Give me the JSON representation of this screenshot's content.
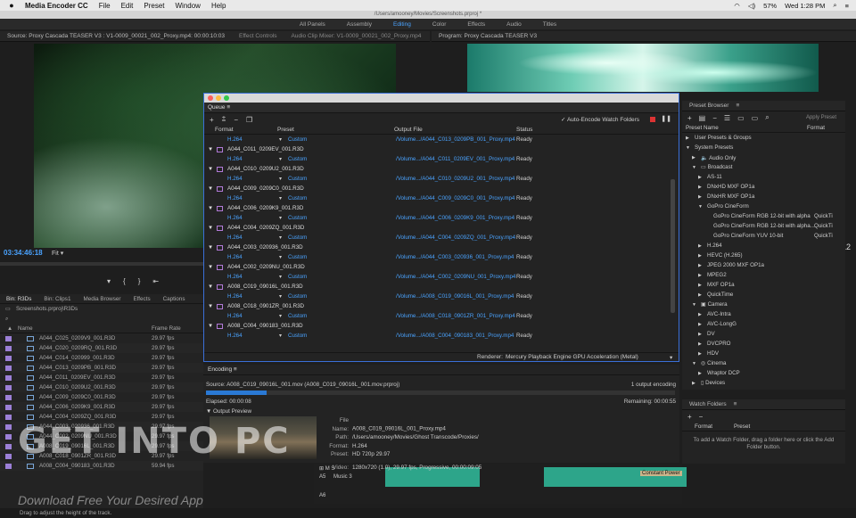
{
  "menubar": {
    "app": "Media Encoder CC",
    "items": [
      "File",
      "Edit",
      "Preset",
      "Window",
      "Help"
    ],
    "battery": "57%",
    "clock": "Wed 1:28 PM"
  },
  "window_title": "/Users/amooney/Movies/Screenshots.prproj *",
  "workspaces": [
    "All Panels",
    "Assembly",
    "Editing",
    "Color",
    "Effects",
    "Audio",
    "Titles"
  ],
  "source_panel": {
    "title": "Source: Proxy Cascada TEASER V3 : V1-0009_00021_002_Proxy.mp4: 00:00:10:03",
    "tab2": "Effect Controls",
    "tab3": "Audio Clip Mixer: V1-0009_00021_002_Proxy.mp4",
    "timecode": "03:34:46:18",
    "fit": "Fit"
  },
  "program_panel": {
    "title": "Program: Proxy Cascada TEASER V3"
  },
  "queue": {
    "tab": "Queue",
    "auto_encode": "✓ Auto-Encode Watch Folders",
    "headers": {
      "format": "Format",
      "preset": "Preset",
      "output": "Output File",
      "status": "Status"
    },
    "rows": [
      {
        "kind": "out",
        "format": "H.264",
        "preset": "Custom",
        "file": "/Volume.../A044_C013_0209PB_001_Proxy.mp4",
        "status": "Ready"
      },
      {
        "kind": "src",
        "name": "A044_C011_0209EV_001.R3D"
      },
      {
        "kind": "out",
        "format": "H.264",
        "preset": "Custom",
        "file": "/Volume.../A044_C011_0209EV_001_Proxy.mp4",
        "status": "Ready"
      },
      {
        "kind": "src",
        "name": "A044_C010_0209U2_001.R3D"
      },
      {
        "kind": "out",
        "format": "H.264",
        "preset": "Custom",
        "file": "/Volume.../A044_C010_0209U2_001_Proxy.mp4",
        "status": "Ready"
      },
      {
        "kind": "src",
        "name": "A044_C009_0209C0_001.R3D"
      },
      {
        "kind": "out",
        "format": "H.264",
        "preset": "Custom",
        "file": "/Volume.../A044_C009_0209C0_001_Proxy.mp4",
        "status": "Ready"
      },
      {
        "kind": "src",
        "name": "A044_C006_0209K9_001.R3D"
      },
      {
        "kind": "out",
        "format": "H.264",
        "preset": "Custom",
        "file": "/Volume.../A044_C006_0209K9_001_Proxy.mp4",
        "status": "Ready"
      },
      {
        "kind": "src",
        "name": "A044_C004_0209ZQ_001.R3D"
      },
      {
        "kind": "out",
        "format": "H.264",
        "preset": "Custom",
        "file": "/Volume.../A044_C004_0209ZQ_001_Proxy.mp4",
        "status": "Ready"
      },
      {
        "kind": "src",
        "name": "A044_C003_020936_001.R3D"
      },
      {
        "kind": "out",
        "format": "H.264",
        "preset": "Custom",
        "file": "/Volume.../A044_C003_020936_001_Proxy.mp4",
        "status": "Ready"
      },
      {
        "kind": "src",
        "name": "A044_C002_0209NU_001.R3D"
      },
      {
        "kind": "out",
        "format": "H.264",
        "preset": "Custom",
        "file": "/Volume.../A044_C002_0209NU_001_Proxy.mp4",
        "status": "Ready"
      },
      {
        "kind": "src",
        "name": "A008_C019_09016L_001.R3D"
      },
      {
        "kind": "out",
        "format": "H.264",
        "preset": "Custom",
        "file": "/Volume.../A008_C019_09016L_001_Proxy.mp4",
        "status": "Ready"
      },
      {
        "kind": "src",
        "name": "A008_C018_0901ZR_001.R3D"
      },
      {
        "kind": "out",
        "format": "H.264",
        "preset": "Custom",
        "file": "/Volume.../A008_C018_0901ZR_001_Proxy.mp4",
        "status": "Ready"
      },
      {
        "kind": "src",
        "name": "A008_C004_090183_001.R3D"
      },
      {
        "kind": "out",
        "format": "H.264",
        "preset": "Custom",
        "file": "/Volume.../A008_C004_090183_001_Proxy.mp4",
        "status": "Ready"
      }
    ],
    "renderer_label": "Renderer:",
    "renderer_value": "Mercury Playback Engine GPU Acceleration (Metal)"
  },
  "encoding": {
    "tab": "Encoding",
    "source": "Source: A008_C019_09016L_001.mov (A008_C019_09016L_001.mov.prproj)",
    "count": "1 output encoding",
    "progress": 0.13,
    "elapsed": "Elapsed: 00:00:08",
    "remaining": "Remaining: 00:00:55",
    "preview_label": "Output Preview",
    "meta": [
      {
        "k": "File Name:",
        "v": "A008_C019_09016L_001_Proxy.mp4"
      },
      {
        "k": "Path:",
        "v": "/Users/amooney/Movies/Ghost Transcode/Proxies/"
      },
      {
        "k": "Format:",
        "v": "H.264"
      },
      {
        "k": "Preset:",
        "v": "HD 720p 29.97"
      },
      {
        "k": "Video:",
        "v": "1280x720 (1.0), 29.97 fps, Progressive, 00:00:09:05"
      }
    ]
  },
  "preset_browser": {
    "title": "Preset Browser",
    "apply": "Apply Preset",
    "col_name": "Preset Name",
    "col_format": "Format",
    "rows": [
      {
        "indent": 0,
        "arrow": "▶",
        "label": "User Presets & Groups",
        "fmt": ""
      },
      {
        "indent": 0,
        "arrow": "▼",
        "label": "System Presets",
        "fmt": ""
      },
      {
        "indent": 1,
        "arrow": "▶",
        "label": "🔈 Audio Only",
        "fmt": ""
      },
      {
        "indent": 1,
        "arrow": "▼",
        "label": "▭ Broadcast",
        "fmt": ""
      },
      {
        "indent": 2,
        "arrow": "▶",
        "label": "AS-11",
        "fmt": ""
      },
      {
        "indent": 2,
        "arrow": "▶",
        "label": "DNxHD MXF OP1a",
        "fmt": ""
      },
      {
        "indent": 2,
        "arrow": "▶",
        "label": "DNxHR MXF OP1a",
        "fmt": ""
      },
      {
        "indent": 2,
        "arrow": "▼",
        "label": "GoPro CineForm",
        "fmt": ""
      },
      {
        "indent": 3,
        "arrow": "",
        "label": "GoPro CineForm RGB 12-bit with alpha",
        "fmt": "QuickTi"
      },
      {
        "indent": 3,
        "arrow": "",
        "label": "GoPro CineForm RGB 12-bit with alpha...",
        "fmt": "QuickTi"
      },
      {
        "indent": 3,
        "arrow": "",
        "label": "GoPro CineForm YUV 10-bit",
        "fmt": "QuickTi"
      },
      {
        "indent": 2,
        "arrow": "▶",
        "label": "H.264",
        "fmt": ""
      },
      {
        "indent": 2,
        "arrow": "▶",
        "label": "HEVC (H.265)",
        "fmt": ""
      },
      {
        "indent": 2,
        "arrow": "▶",
        "label": "JPEG 2000 MXF OP1a",
        "fmt": ""
      },
      {
        "indent": 2,
        "arrow": "▶",
        "label": "MPEG2",
        "fmt": ""
      },
      {
        "indent": 2,
        "arrow": "▶",
        "label": "MXF OP1a",
        "fmt": ""
      },
      {
        "indent": 2,
        "arrow": "▶",
        "label": "QuickTime",
        "fmt": ""
      },
      {
        "indent": 1,
        "arrow": "▼",
        "label": "▣ Camera",
        "fmt": ""
      },
      {
        "indent": 2,
        "arrow": "▶",
        "label": "AVC-Intra",
        "fmt": ""
      },
      {
        "indent": 2,
        "arrow": "▶",
        "label": "AVC-LongG",
        "fmt": ""
      },
      {
        "indent": 2,
        "arrow": "▶",
        "label": "DV",
        "fmt": ""
      },
      {
        "indent": 2,
        "arrow": "▶",
        "label": "DVCPRO",
        "fmt": ""
      },
      {
        "indent": 2,
        "arrow": "▶",
        "label": "HDV",
        "fmt": ""
      },
      {
        "indent": 1,
        "arrow": "▼",
        "label": "◎ Cinema",
        "fmt": ""
      },
      {
        "indent": 2,
        "arrow": "▶",
        "label": "Wraptor DCP",
        "fmt": ""
      },
      {
        "indent": 1,
        "arrow": "▶",
        "label": "▯ Devices",
        "fmt": ""
      }
    ]
  },
  "watch_folders": {
    "title": "Watch Folders",
    "col_format": "Format",
    "col_preset": "Preset",
    "hint": "To add a Watch Folder, drag a folder here or click the Add Folder button."
  },
  "bin": {
    "tabs": [
      "Bin: R3Ds",
      "Bin: Clips1",
      "Media Browser",
      "Effects",
      "Captions"
    ],
    "path": "Screenshots.prproj\\R3Ds",
    "col_name": "Name",
    "col_fps": "Frame Rate",
    "rows": [
      {
        "name": "A044_C025_0209V9_001.R3D",
        "fps": "29.97 fps",
        "s": "",
        "e": ""
      },
      {
        "name": "A044_C020_0209RQ_001.R3D",
        "fps": "29.97 fps",
        "s": "",
        "e": ""
      },
      {
        "name": "A044_C014_020999_001.R3D",
        "fps": "29.97 fps",
        "s": "",
        "e": ""
      },
      {
        "name": "A044_C013_0209PB_001.R3D",
        "fps": "29.97 fps",
        "s": "",
        "e": ""
      },
      {
        "name": "A044_C011_0209EV_001.R3D",
        "fps": "29.97 fps",
        "s": "",
        "e": ""
      },
      {
        "name": "A044_C010_0209U2_001.R3D",
        "fps": "29.97 fps",
        "s": "",
        "e": ""
      },
      {
        "name": "A044_C009_0209C0_001.R3D",
        "fps": "29.97 fps",
        "s": "",
        "e": ""
      },
      {
        "name": "A044_C006_0209K9_001.R3D",
        "fps": "29.97 fps",
        "s": "",
        "e": ""
      },
      {
        "name": "A044_C004_0209ZQ_001.R3D",
        "fps": "29.97 fps",
        "s": "",
        "e": ""
      },
      {
        "name": "A044_C003_020936_001.R3D",
        "fps": "29.97 fps",
        "s": "",
        "e": ""
      },
      {
        "name": "A044_C002_0209NU_001.R3D",
        "fps": "29.97 fps",
        "s": "",
        "e": ""
      },
      {
        "name": "A008_C019_09016L_001.R3D",
        "fps": "29.97 fps",
        "s": "",
        "e": ""
      },
      {
        "name": "A008_C018_0901ZR_001.R3D",
        "fps": "29.97 fps",
        "s": "13:32:47:05",
        "e": "13:32:57:17"
      },
      {
        "name": "A008_C004_090183_001.R3D",
        "fps": "59.94 fps",
        "s": "13:32:13:01",
        "e": "13:32:23:07"
      }
    ]
  },
  "timeline": {
    "track1": "A5",
    "track1_name": "Music 3",
    "track2": "A6",
    "clip_label": "Constant Power"
  },
  "right_edge_num": "12",
  "status": "Drag to adjust the height of the track.",
  "watermark": "GET INTO PC",
  "watermark_sub": "Download Free Your Desired App"
}
